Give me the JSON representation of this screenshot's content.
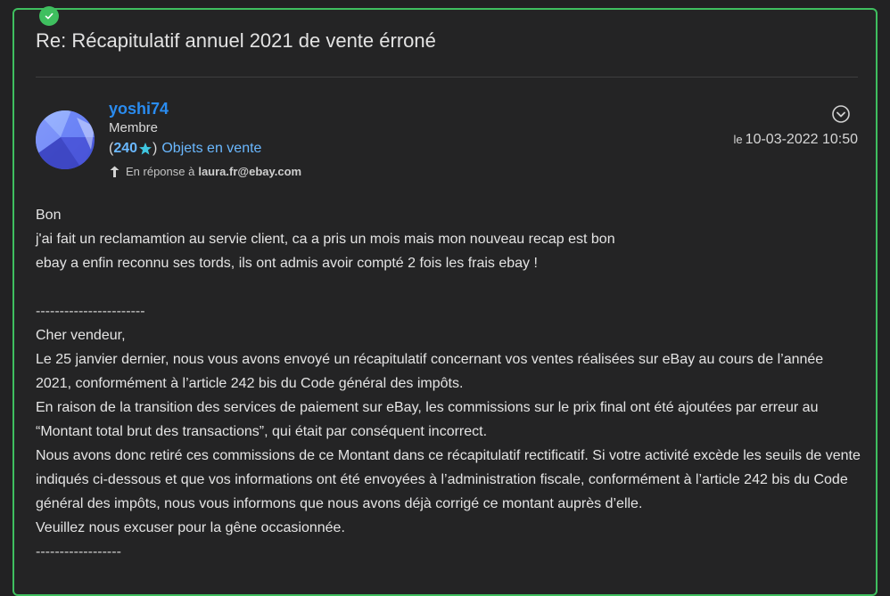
{
  "post": {
    "title": "Re: Récapitulatif annuel 2021 de vente érroné",
    "accent_color": "#3fbf5f"
  },
  "author": {
    "username": "yoshi74",
    "rank": "Membre",
    "feedback_open": "(",
    "feedback_score": "240",
    "feedback_close": ")",
    "listings_label": "Objets en vente",
    "reply_prefix": "En réponse à",
    "reply_target": "laura.fr@ebay.com"
  },
  "meta": {
    "date_prefix": "le",
    "date_value": "10-03-2022 10:50"
  },
  "body": {
    "lines": [
      "Bon",
      "j'ai fait un reclamamtion au servie client, ca a pris un mois mais mon nouveau recap est bon",
      "ebay  a enfin reconnu ses tords, ils ont admis avoir compté 2 fois les frais ebay !"
    ],
    "separator_top": "-----------------------",
    "quoted": [
      "Cher vendeur,",
      "Le 25 janvier dernier, nous vous avons envoyé un récapitulatif concernant vos ventes réalisées sur eBay au cours de l’année 2021, conformément à l’article 242 bis du Code général des impôts.",
      "En raison de la transition des services de paiement sur eBay, les commissions sur le prix final ont été ajoutées par erreur au “Montant total brut des transactions”, qui était par conséquent incorrect.",
      "Nous avons donc retiré ces commissions de ce Montant dans ce récapitulatif rectificatif. Si votre activité excède les seuils de vente indiqués ci-dessous et que vos informations ont été envoyées à l’administration fiscale, conformément à l’article 242 bis du Code général des impôts, nous vous informons que nous avons déjà corrigé ce montant auprès d’elle.",
      "Veuillez nous excuser pour la gêne occasionnée."
    ],
    "separator_bottom": "------------------"
  },
  "icons": {
    "badge": "check-icon",
    "options": "chevron-down-circle-icon",
    "reply": "reply-arrow-icon",
    "star": "star-icon"
  }
}
